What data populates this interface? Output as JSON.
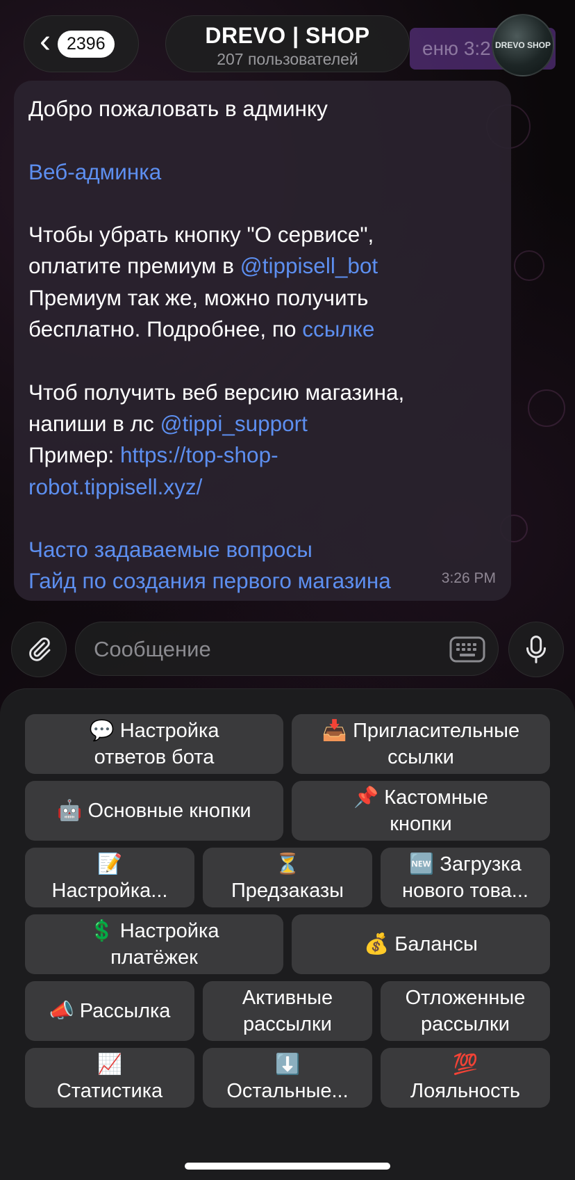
{
  "header": {
    "back_count": "2396",
    "chat_title": "DREVO | SHOP",
    "chat_subtitle": "207 пользователей",
    "pinned_ghost": "еню  3:2",
    "avatar_label": "DREVO SHOP"
  },
  "message": {
    "lines": [
      [
        {
          "t": "Добро пожаловать в админку",
          "link": false
        }
      ],
      [],
      [
        {
          "t": "Веб-админка",
          "link": true
        }
      ],
      [],
      [
        {
          "t": "Чтобы убрать кнопку \"О сервисе\",",
          "link": false
        }
      ],
      [
        {
          "t": "оплатите премиум в ",
          "link": false
        },
        {
          "t": "@tippisell_bot",
          "link": true
        }
      ],
      [
        {
          "t": "Премиум так же, можно получить",
          "link": false
        }
      ],
      [
        {
          "t": "бесплатно. Подробнее, по ",
          "link": false
        },
        {
          "t": "ссылке",
          "link": true
        }
      ],
      [],
      [
        {
          "t": "Чтоб получить веб версию магазина,",
          "link": false
        }
      ],
      [
        {
          "t": "напиши в лс ",
          "link": false
        },
        {
          "t": "@tippi_support",
          "link": true
        }
      ],
      [
        {
          "t": "Пример: ",
          "link": false
        },
        {
          "t": "https://top-shop-",
          "link": true
        }
      ],
      [
        {
          "t": "robot.tippisell.xyz/",
          "link": true
        }
      ],
      [],
      [
        {
          "t": "Часто задаваемые вопросы",
          "link": true
        }
      ],
      [
        {
          "t": "Гайд по создания первого магазина",
          "link": true
        }
      ]
    ],
    "time": "3:26 PM"
  },
  "composer": {
    "placeholder": "Сообщение"
  },
  "keyboard": {
    "rows": [
      [
        {
          "emoji": "💬",
          "label": "Настройка ответов бота",
          "stack": false,
          "lines": [
            "💬 Настройка",
            "ответов бота"
          ]
        },
        {
          "emoji": "📥",
          "label": "Пригласительные ссылки",
          "stack": false,
          "lines": [
            "📥 Пригласительные",
            "ссылки"
          ]
        }
      ],
      [
        {
          "lines": [
            "🤖 Основные кнопки"
          ]
        },
        {
          "lines": [
            "📌 Кастомные",
            "кнопки"
          ]
        }
      ],
      [
        {
          "lines": [
            "📝",
            "Настройка..."
          ]
        },
        {
          "lines": [
            "⏳",
            "Предзаказы"
          ]
        },
        {
          "lines": [
            "🆕 Загрузка",
            "нового това..."
          ]
        }
      ],
      [
        {
          "lines": [
            "💲 Настройка",
            "платёжек"
          ]
        },
        {
          "lines": [
            "💰 Балансы"
          ]
        }
      ],
      [
        {
          "lines": [
            "📣 Рассылка"
          ]
        },
        {
          "lines": [
            "Активные",
            "рассылки"
          ]
        },
        {
          "lines": [
            "Отложенные",
            "рассылки"
          ]
        }
      ],
      [
        {
          "lines": [
            "📈",
            "Статистика"
          ]
        },
        {
          "lines": [
            "⬇️",
            "Остальные..."
          ]
        },
        {
          "lines": [
            "💯",
            "Лояльность"
          ]
        }
      ]
    ],
    "names": [
      [
        "kb-bot-replies-settings-button",
        "kb-invite-links-button"
      ],
      [
        "kb-main-buttons-button",
        "kb-custom-buttons-button"
      ],
      [
        "kb-settings-button",
        "kb-preorders-button",
        "kb-upload-product-button"
      ],
      [
        "kb-payments-settings-button",
        "kb-balances-button"
      ],
      [
        "kb-mailing-button",
        "kb-active-mailings-button",
        "kb-scheduled-mailings-button"
      ],
      [
        "kb-statistics-button",
        "kb-other-button",
        "kb-loyalty-button"
      ]
    ]
  }
}
